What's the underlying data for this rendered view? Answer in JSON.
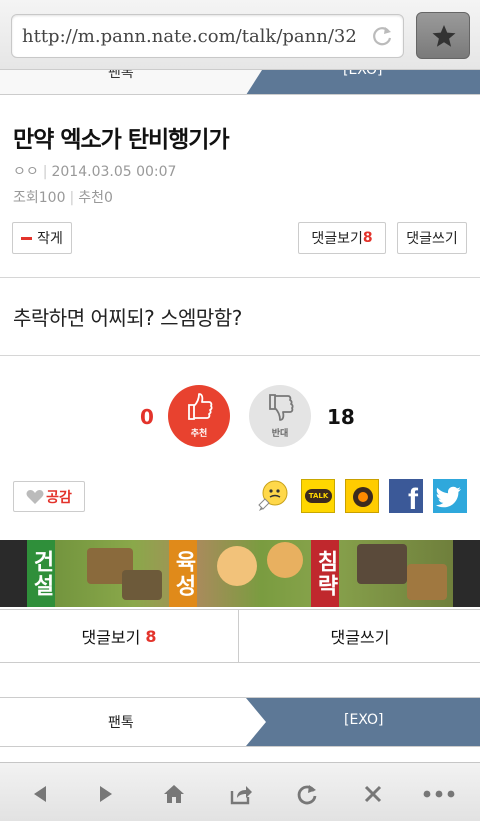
{
  "browser": {
    "url": "http://m.pann.nate.com/talk/pann/32",
    "bookmark_icon": "star-icon",
    "reload_icon": "reload-icon"
  },
  "tabs": {
    "left": "팬톡",
    "right": "[EXO]"
  },
  "post": {
    "title": "만약 엑소가 탄비행기가",
    "author": "ㅇㅇ",
    "date": "2014.03.05 00:07",
    "views": "조회100",
    "recommends": "추천0",
    "font_small_label": "작게",
    "comments_view_label": "댓글보기",
    "comments_count": "8",
    "comments_write_label": "댓글쓰기",
    "body": "추락하면 어찌되? 스엠망함?"
  },
  "vote": {
    "up_count": "0",
    "up_label": "추천",
    "down_label": "반대",
    "down_count": "18",
    "up_color": "#e8422f"
  },
  "actions": {
    "empathy_label": "공감",
    "talk_label": "TALK",
    "fb_label": "f"
  },
  "banner": {
    "words": [
      "건설",
      "육성",
      "침략"
    ]
  },
  "comment_bar": {
    "view_label": "댓글보기",
    "count": "8",
    "write_label": "댓글쓰기"
  },
  "colors": {
    "accent_red": "#e3332b",
    "tab_blue": "#5d7896"
  }
}
